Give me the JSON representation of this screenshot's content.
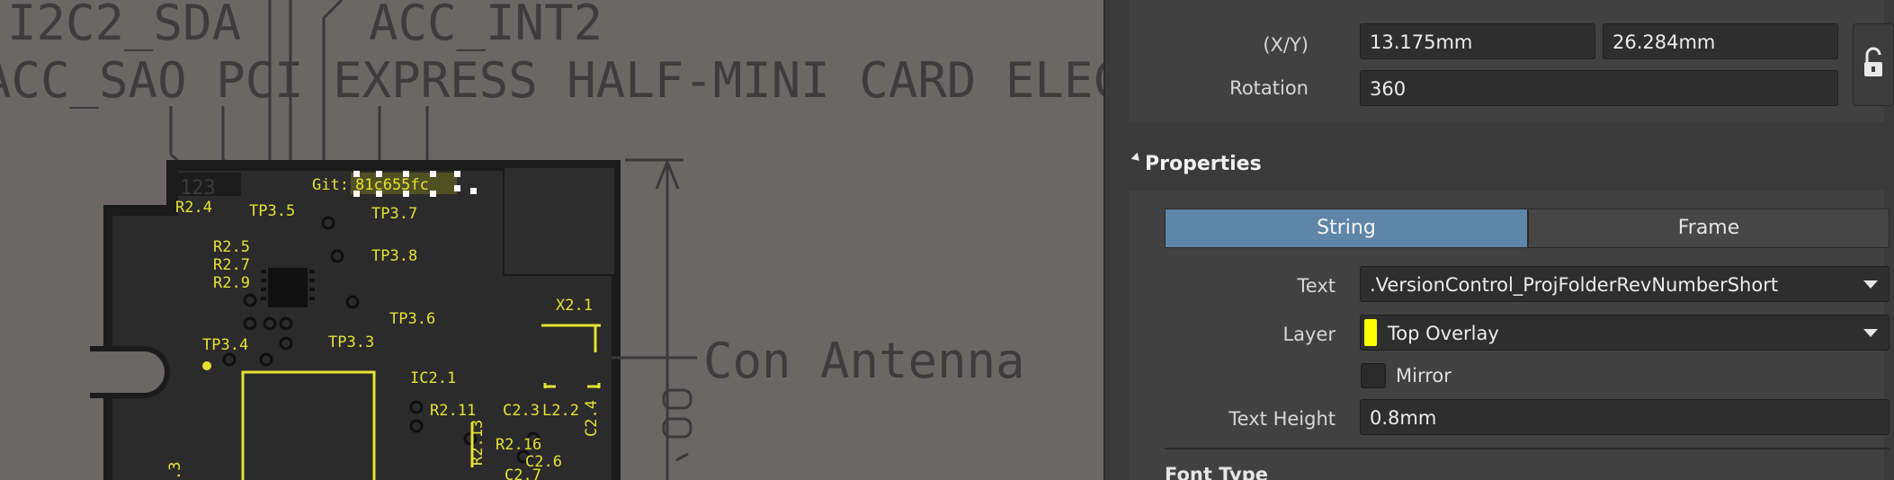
{
  "canvas": {
    "big_texts": [
      "I2C2_SDA",
      "ACC_INT2",
      "ACC_SAO PCI EXPRESS HALF-MINI CARD ELEC",
      "Con Antenna"
    ],
    "silk_labels": [
      "R2.4",
      "TP3.5",
      "TP3.7",
      "R2.5",
      "R2.7",
      "R2.9",
      "TP3.8",
      "TP3.6",
      "TP3.4",
      "TP3.3",
      "X2.1",
      "IC2.1",
      "R2.11",
      "C2.3",
      "L2.2",
      "C2.4",
      "R2.13",
      "R2.16",
      "C2.6",
      "C2.7"
    ],
    "git_label": "Git:",
    "git_hash": "81c655fc",
    "logo_text": "123"
  },
  "panel": {
    "location": {
      "xy_label": "(X/Y)",
      "x_value": "13.175mm",
      "y_value": "26.284mm",
      "rotation_label": "Rotation",
      "rotation_value": "360"
    },
    "properties": {
      "header": "Properties",
      "tab_string": "String",
      "tab_frame": "Frame",
      "text_label": "Text",
      "text_value": ".VersionControl_ProjFolderRevNumberShort",
      "layer_label": "Layer",
      "layer_value": "Top Overlay",
      "layer_color": "#ffff00",
      "mirror_label": "Mirror",
      "text_height_label": "Text Height",
      "text_height_value": "0.8mm",
      "font_type_label": "Font Type"
    }
  }
}
